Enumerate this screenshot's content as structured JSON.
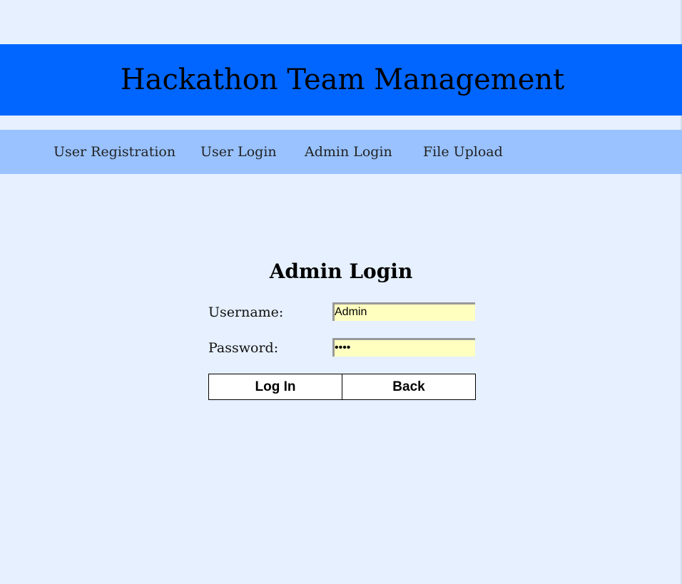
{
  "header": {
    "title": "Hackathon Team Management"
  },
  "nav": {
    "items": [
      {
        "label": "User Registration"
      },
      {
        "label": "User Login"
      },
      {
        "label": "Admin Login"
      },
      {
        "label": "File Upload"
      }
    ]
  },
  "form": {
    "title": "Admin Login",
    "username_label": "Username:",
    "username_value": "Admin",
    "password_label": "Password:",
    "password_value": "••••",
    "login_label": "Log In",
    "back_label": "Back"
  },
  "colors": {
    "page_background": "#e6f0fe",
    "header_background": "#0066ff",
    "nav_background": "#99c2ff",
    "input_background": "#ffffc0"
  }
}
